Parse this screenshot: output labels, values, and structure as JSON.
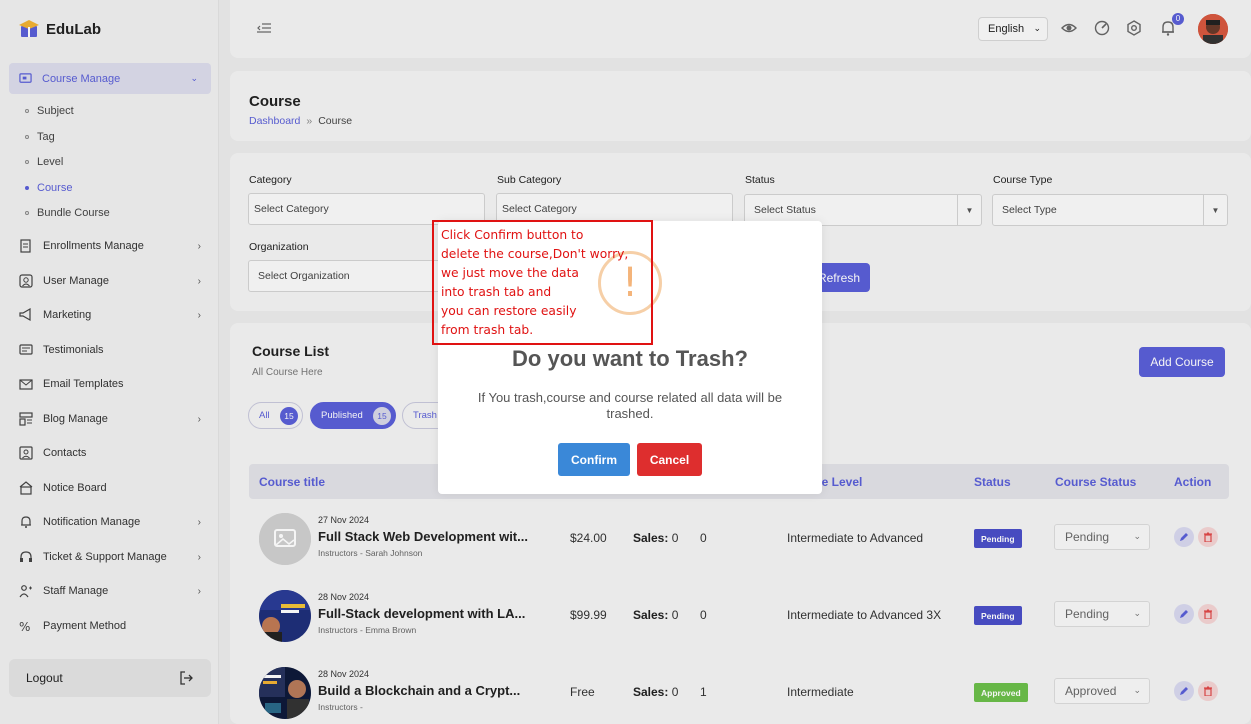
{
  "sidebar": {
    "brand": "EduLab",
    "active_group": "Course Manage",
    "sub_items": [
      "Subject",
      "Tag",
      "Level",
      "Course",
      "Bundle Course"
    ],
    "items": [
      "Enrollments Manage",
      "User Manage",
      "Marketing",
      "Testimonials",
      "Email Templates",
      "Blog Manage",
      "Contacts",
      "Notice Board",
      "Notification Manage",
      "Ticket & Support Manage",
      "Staff Manage",
      "Payment Method"
    ],
    "logout": "Logout"
  },
  "header": {
    "language": "English",
    "notification_count": "0"
  },
  "page": {
    "title": "Course",
    "breadcrumb_home": "Dashboard",
    "breadcrumb_sep": "»",
    "breadcrumb_current": "Course"
  },
  "filters": {
    "category_label": "Category",
    "category_placeholder": "Select Category",
    "subcategory_label": "Sub Category",
    "subcategory_placeholder": "Select Category",
    "status_label": "Status",
    "status_placeholder": "Select Status",
    "type_label": "Course Type",
    "type_placeholder": "Select Type",
    "org_label": "Organization",
    "org_placeholder": "Select Organization",
    "refresh": "Refresh"
  },
  "course_list": {
    "title": "Course List",
    "subtitle": "All Course Here",
    "add_button": "Add Course",
    "tabs": [
      {
        "label": "All",
        "count": "15"
      },
      {
        "label": "Published",
        "count": "15"
      },
      {
        "label": "Trash",
        "count": ""
      }
    ],
    "columns": {
      "title": "Course title",
      "level": "Course Level",
      "status": "Status",
      "course_status": "Course Status",
      "action": "Action"
    },
    "rows": [
      {
        "date": "27 Nov 2024",
        "title": "Full Stack Web Development wit...",
        "instructor": "Instructors - Sarah Johnson",
        "price": "$24.00",
        "sales_label": "Sales:",
        "sales": "0",
        "enrolled": "0",
        "level": "Intermediate to Advanced",
        "status": "Pending",
        "course_status": "Pending"
      },
      {
        "date": "28 Nov 2024",
        "title": "Full-Stack development with LA...",
        "instructor": "Instructors - Emma Brown",
        "price": "$99.99",
        "sales_label": "Sales:",
        "sales": "0",
        "enrolled": "0",
        "level": "Intermediate to Advanced 3X",
        "status": "Pending",
        "course_status": "Pending"
      },
      {
        "date": "28 Nov 2024",
        "title": "Build a Blockchain and a Crypt...",
        "instructor": "Instructors -",
        "price": "Free",
        "sales_label": "Sales:",
        "sales": "0",
        "enrolled": "1",
        "level": "Intermediate",
        "status": "Approved",
        "course_status": "Approved"
      }
    ]
  },
  "modal": {
    "icon": "!",
    "title": "Do you want to Trash?",
    "text": "If You trash,course and course related all data will be trashed.",
    "confirm": "Confirm",
    "cancel": "Cancel"
  },
  "annotation": {
    "lines": [
      "Click  Confirm button to",
      "delete the course,Don't worry,",
      "we just move the data",
      "into trash tab and",
      "you can restore easily",
      "from trash tab."
    ]
  },
  "colors": {
    "accent": "#5a5fd8",
    "confirm": "#3a88d8",
    "cancel": "#de2e2e",
    "annotation": "#e01212"
  }
}
